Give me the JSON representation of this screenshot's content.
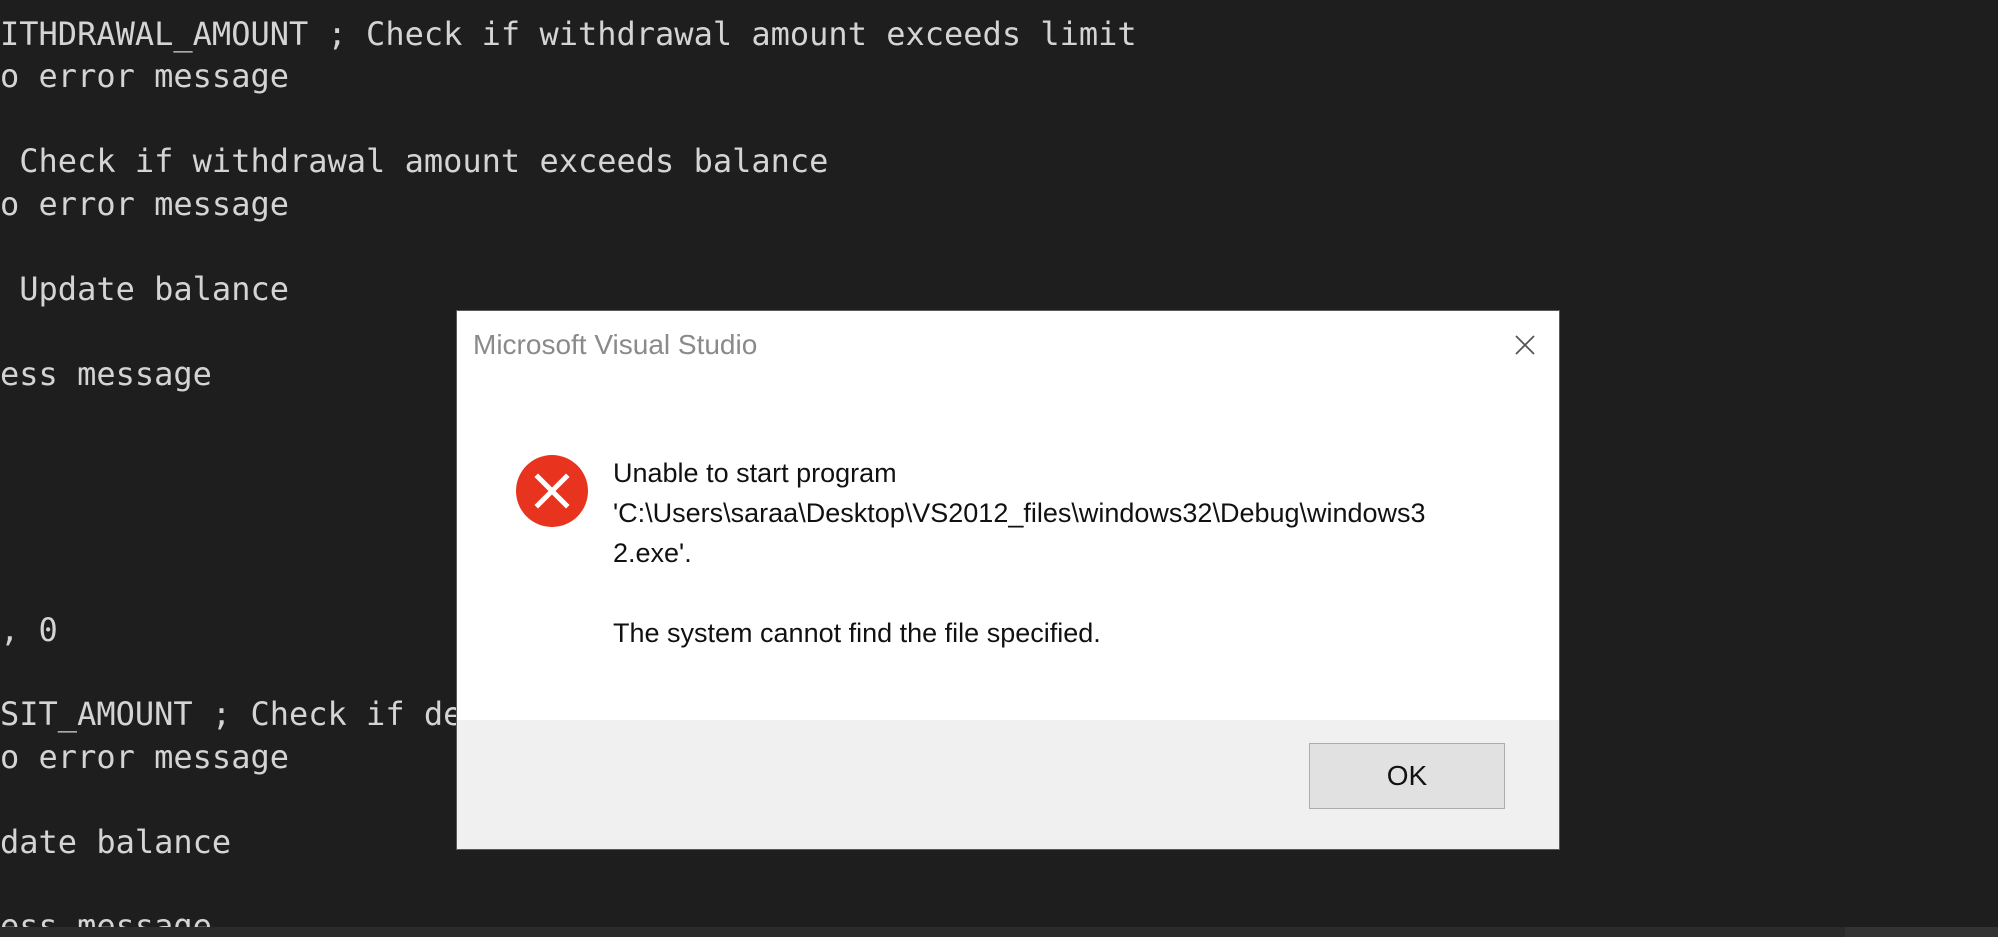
{
  "editor": {
    "lines": [
      "ITHDRAWAL_AMOUNT ; Check if withdrawal amount exceeds limit",
      "o error message",
      " Check if withdrawal amount exceeds balance",
      "o error message",
      " Update balance",
      "ess message",
      ", 0",
      "SIT_AMOUNT ; Check if dep",
      "o error message",
      "date balance",
      "ess message"
    ]
  },
  "dialog": {
    "title": "Microsoft Visual Studio",
    "close_icon": "close-icon",
    "error_icon": "error-icon",
    "error_color": "#e8331f",
    "message_line1": "Unable to start program",
    "message_line2": "'C:\\Users\\saraa\\Desktop\\VS2012_files\\windows32\\Debug\\windows3",
    "message_line3": "2.exe'.",
    "message_line4": "The system cannot find the file specified.",
    "ok_label": "OK"
  }
}
